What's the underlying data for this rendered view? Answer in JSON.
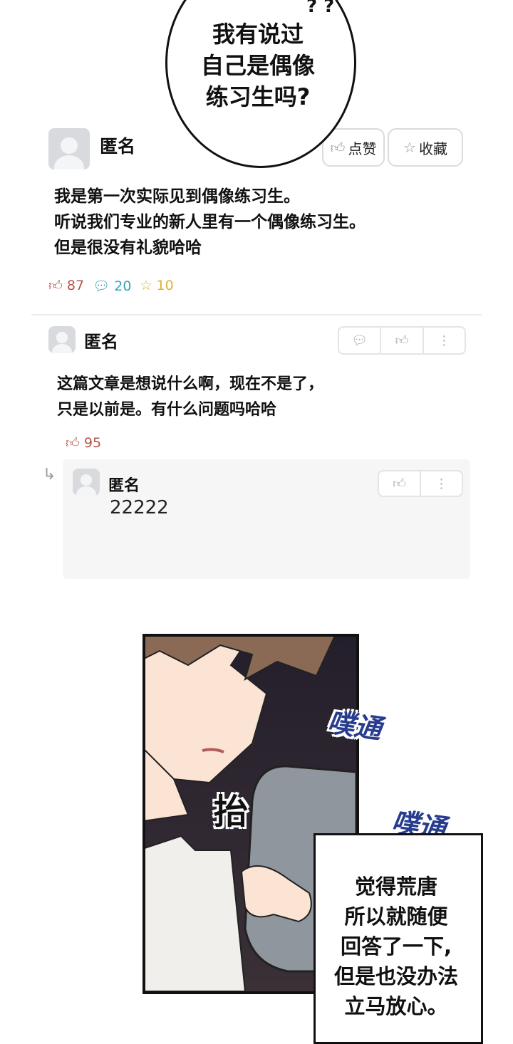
{
  "bubble": {
    "lines": [
      "我有说过",
      "自己是偶像",
      "练习生吗?"
    ]
  },
  "post": {
    "author": "匿名",
    "like_button": "点赞",
    "favorite_button": "收藏",
    "lines": [
      "我是第一次实际见到偶像练习生。",
      "听说我们专业的新人里有一个偶像练习生。",
      "但是很没有礼貌哈哈"
    ],
    "likes": "87",
    "comments": "20",
    "favorites": "10"
  },
  "comment": {
    "author": "匿名",
    "lines": [
      "这篇文章是想说什么啊，现在不是了，",
      "只是以前是。有什么问题吗哈哈"
    ],
    "likes": "95"
  },
  "reply": {
    "author": "匿名",
    "text": "22222"
  },
  "comic": {
    "sfx_1": "噗通",
    "sfx_2": "噗通",
    "sfx_action": "抬",
    "narration": [
      "觉得荒唐",
      "所以就随便",
      "回答了一下,",
      "但是也没办法",
      "立马放心。"
    ]
  },
  "colors": {
    "like": "#b5524c",
    "comment": "#3aa0b9",
    "favorite": "#d9b431",
    "sfx": "#273c8f"
  }
}
